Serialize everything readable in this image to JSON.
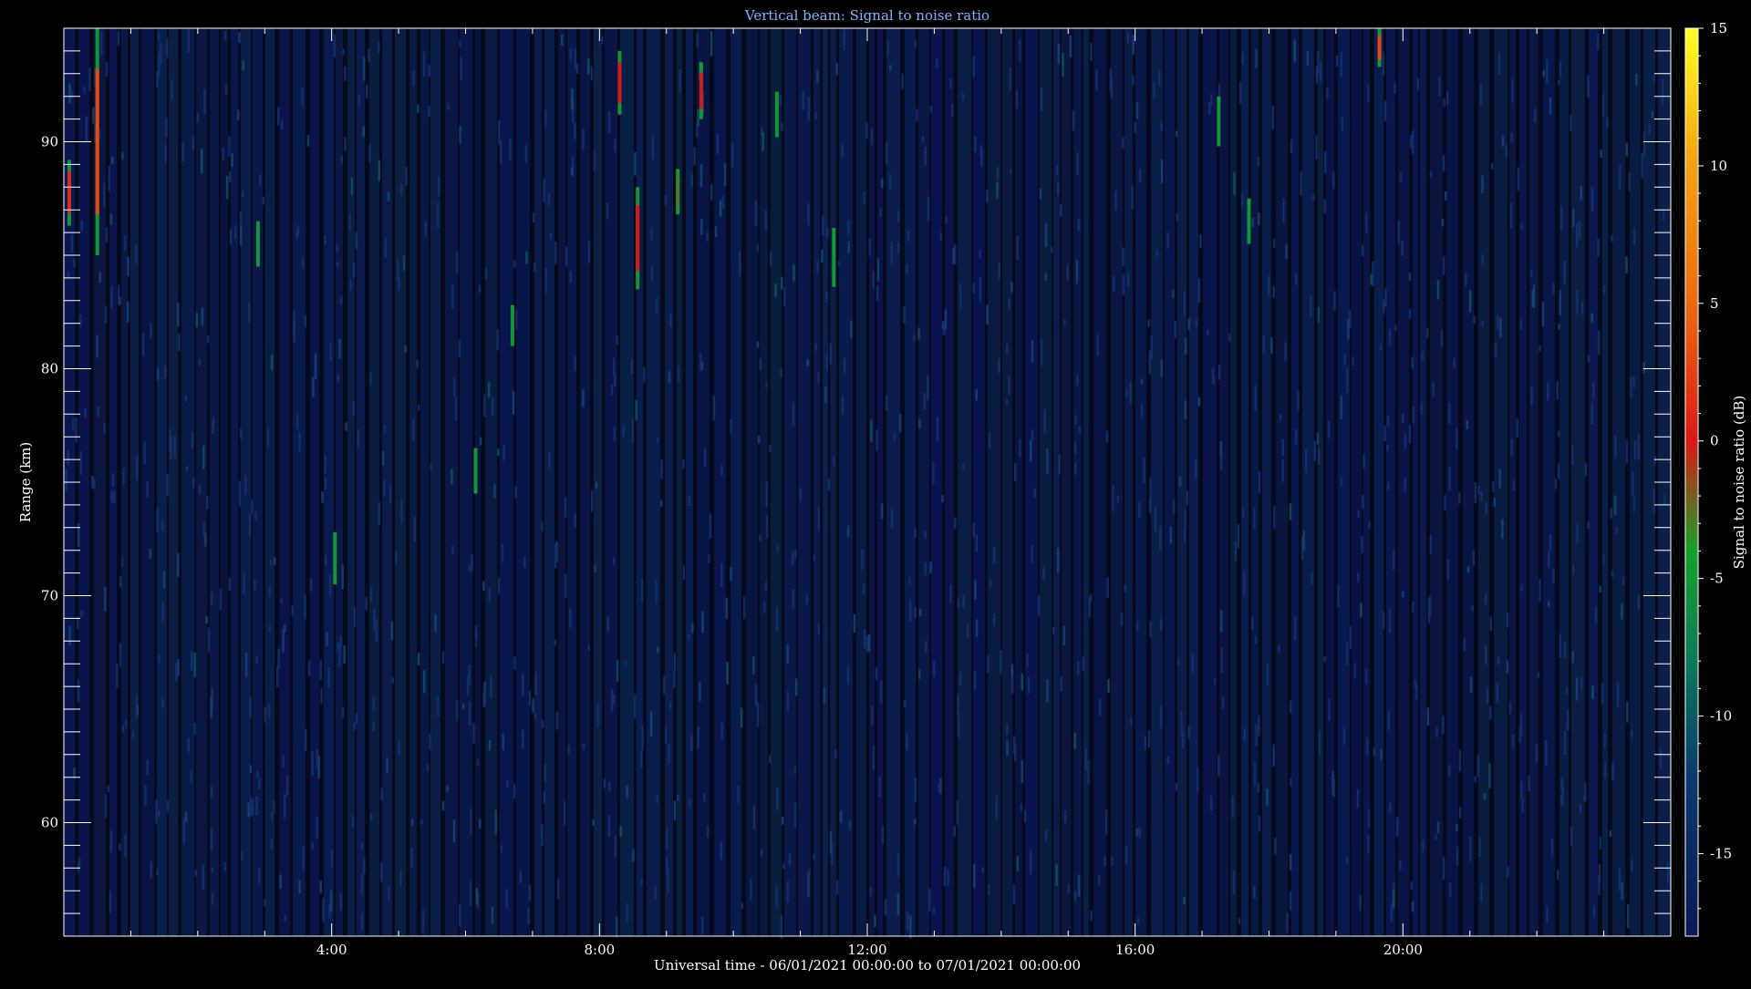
{
  "chart_data": {
    "type": "heatmap",
    "title": "Vertical beam: Signal to noise ratio",
    "xlabel": "Universal time - 06/01/2021 00:00:00 to 07/01/2021 00:00:00",
    "ylabel": "Range (km)",
    "colorbar_label": "Signal to noise ratio (dB)",
    "xlim_hours": [
      0,
      24
    ],
    "ylim_km": [
      55,
      95
    ],
    "x_ticks": [
      {
        "hour": 4,
        "label": "4:00"
      },
      {
        "hour": 8,
        "label": "8:00"
      },
      {
        "hour": 12,
        "label": "12:00"
      },
      {
        "hour": 16,
        "label": "16:00"
      },
      {
        "hour": 20,
        "label": "20:00"
      }
    ],
    "y_ticks": [
      {
        "km": 60,
        "label": "60"
      },
      {
        "km": 70,
        "label": "70"
      },
      {
        "km": 80,
        "label": "80"
      },
      {
        "km": 90,
        "label": "90"
      }
    ],
    "colorbar_range_db": [
      -18,
      15
    ],
    "colorbar_ticks": [
      {
        "db": 15,
        "label": "15"
      },
      {
        "db": 10,
        "label": "10"
      },
      {
        "db": 5,
        "label": "5"
      },
      {
        "db": 0,
        "label": "0"
      },
      {
        "db": -5,
        "label": "-5"
      },
      {
        "db": -10,
        "label": "-10"
      },
      {
        "db": -15,
        "label": "-15"
      }
    ],
    "colormap": [
      {
        "db": -18,
        "color": "#0a1a55"
      },
      {
        "db": -12,
        "color": "#0b3b6e"
      },
      {
        "db": -8,
        "color": "#0b7a5a"
      },
      {
        "db": -4,
        "color": "#16a02a"
      },
      {
        "db": 0,
        "color": "#d81818"
      },
      {
        "db": 5,
        "color": "#ee6a10"
      },
      {
        "db": 10,
        "color": "#f3a010"
      },
      {
        "db": 15,
        "color": "#ffff22"
      }
    ],
    "background_snr_db": -16,
    "notable_echoes": [
      {
        "hour": 0.08,
        "range_km": [
          86.3,
          89.2
        ],
        "snr_db": 1
      },
      {
        "hour": 0.5,
        "range_km": [
          85.0,
          95.0
        ],
        "snr_db": 3
      },
      {
        "hour": 2.9,
        "range_km": [
          84.5,
          86.5
        ],
        "snr_db": -5
      },
      {
        "hour": 4.05,
        "range_km": [
          70.5,
          72.8
        ],
        "snr_db": -5
      },
      {
        "hour": 6.15,
        "range_km": [
          74.5,
          76.5
        ],
        "snr_db": -5
      },
      {
        "hour": 6.7,
        "range_km": [
          81.0,
          82.8
        ],
        "snr_db": -6
      },
      {
        "hour": 8.3,
        "range_km": [
          91.2,
          94.0
        ],
        "snr_db": 0
      },
      {
        "hour": 8.57,
        "range_km": [
          83.5,
          88.0
        ],
        "snr_db": 0
      },
      {
        "hour": 9.17,
        "range_km": [
          86.8,
          88.8
        ],
        "snr_db": -3
      },
      {
        "hour": 9.52,
        "range_km": [
          91.0,
          93.5
        ],
        "snr_db": 0
      },
      {
        "hour": 10.65,
        "range_km": [
          90.2,
          92.2
        ],
        "snr_db": -5
      },
      {
        "hour": 11.5,
        "range_km": [
          83.6,
          86.2
        ],
        "snr_db": -5
      },
      {
        "hour": 17.25,
        "range_km": [
          89.8,
          92.0
        ],
        "snr_db": -5
      },
      {
        "hour": 17.7,
        "range_km": [
          85.5,
          87.5
        ],
        "snr_db": -5
      },
      {
        "hour": 19.65,
        "range_km": [
          93.3,
          95.0
        ],
        "snr_db": 3
      }
    ]
  }
}
